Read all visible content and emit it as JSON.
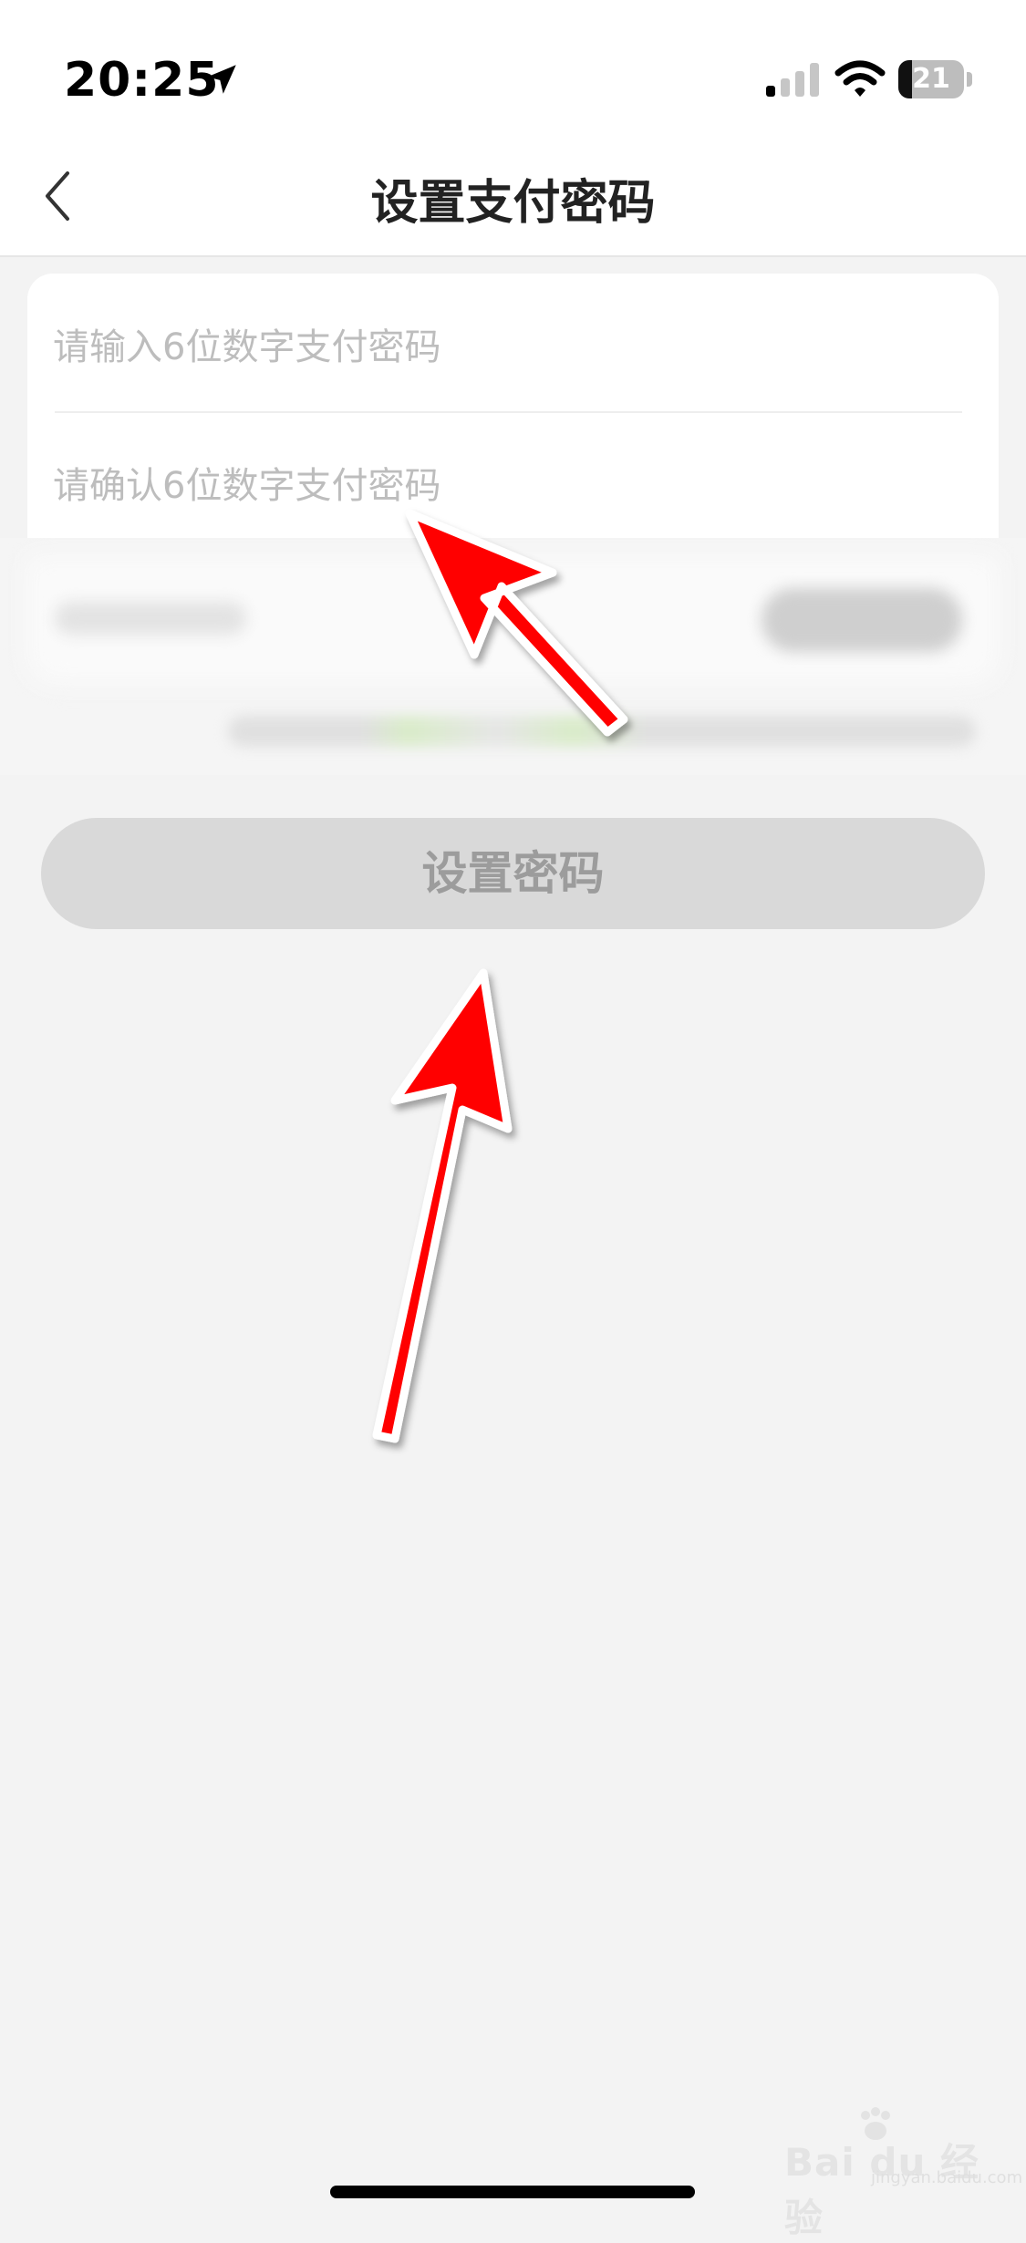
{
  "status_bar": {
    "time": "20:25",
    "battery_level": "21",
    "battery_fraction": 0.21,
    "icons": [
      "location-arrow-icon",
      "cellular-signal-icon",
      "wifi-icon",
      "battery-icon"
    ]
  },
  "nav": {
    "title": "设置支付密码",
    "back_icon": "chevron-left-icon"
  },
  "form": {
    "password_placeholder": "请输入6位数字支付密码",
    "confirm_placeholder": "请确认6位数字支付密码"
  },
  "actions": {
    "submit_label": "设置密码"
  },
  "watermark": {
    "logo_text": "Bai du 经验",
    "sub_text": "jingyan.baidu.com"
  },
  "colors": {
    "background": "#f3f3f3",
    "card": "#ffffff",
    "placeholder_text": "#bdbdbd",
    "button_disabled_bg": "#d9d9d9",
    "button_disabled_text": "#9c9c9c",
    "annotation_arrow": "#ff0000"
  }
}
